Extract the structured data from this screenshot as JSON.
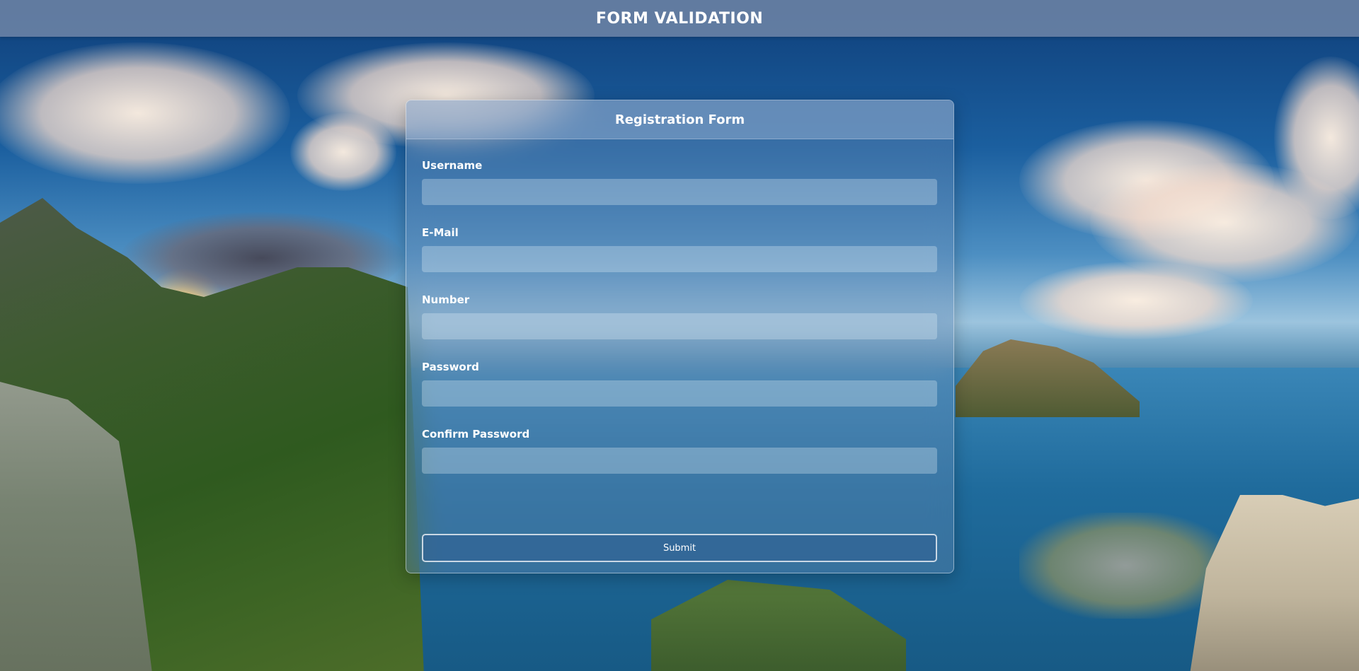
{
  "header": {
    "title": "FORM VALIDATION"
  },
  "form": {
    "title": "Registration Form",
    "fields": [
      {
        "label": "Username",
        "value": "",
        "placeholder": ""
      },
      {
        "label": "E-Mail",
        "value": "",
        "placeholder": ""
      },
      {
        "label": "Number",
        "value": "",
        "placeholder": ""
      },
      {
        "label": "Password",
        "value": "",
        "placeholder": ""
      },
      {
        "label": "Confirm Password",
        "value": "",
        "placeholder": ""
      }
    ],
    "submit_label": "Submit"
  },
  "colors": {
    "header_bg": "#7890aa",
    "text": "#ffffff",
    "button_bg": "#32648f"
  }
}
